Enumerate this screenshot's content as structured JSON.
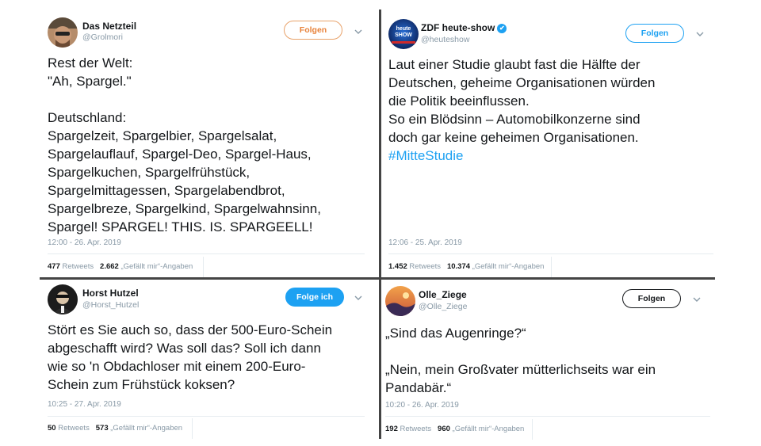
{
  "tweets": [
    {
      "name": "Das Netzteil",
      "handle": "@Grolmori",
      "follow_label": "Folgen",
      "text": "Rest der Welt:\n\"Ah, Spargel.\"\n\nDeutschland:\nSpargelzeit, Spargelbier, Spargelsalat,\nSpargelauflauf, Spargel-Deo, Spargel-Haus,\nSpargelkuchen, Spargelfrühstück,\nSpargelmittagessen, Spargelabendbrot,\nSpargelbreze, Spargelkind, Spargelwahnsinn,\nSpargel! SPARGEL! THIS. IS. SPARGEELL!",
      "timestamp": "12:00 - 26. Apr. 2019",
      "retweets": "477",
      "retweets_label": "Retweets",
      "likes": "2.662",
      "likes_label": "„Gefällt mir“-Angaben"
    },
    {
      "name": "ZDF heute-show",
      "handle": "@heuteshow",
      "verified": "✔",
      "avatar_label": "heute SHOW",
      "follow_label": "Folgen",
      "text": "Laut einer Studie glaubt fast die Hälfte der\nDeutschen, geheime Organisationen würden\ndie Politik beeinflussen.\nSo ein Blödsinn – Automobilkonzerne sind\ndoch gar keine geheimen Organisationen.",
      "hashtag": "#MitteStudie",
      "timestamp": "12:06 - 25. Apr. 2019",
      "retweets": "1.452",
      "retweets_label": "Retweets",
      "likes": "10.374",
      "likes_label": "„Gefällt mir“-Angaben"
    },
    {
      "name": "Horst Hutzel",
      "handle": "@Horst_Hutzel",
      "follow_label": "Folge ich",
      "text": "Stört es Sie auch so, dass der 500-Euro-Schein\nabgeschafft wird? Was soll das? Soll ich dann\nwie so 'n Obdachloser mit einem 200-Euro-\nSchein zum Frühstück koksen?",
      "timestamp": "10:25 - 27. Apr. 2019",
      "retweets": "50",
      "retweets_label": "Retweets",
      "likes": "573",
      "likes_label": "„Gefällt mir“-Angaben"
    },
    {
      "name": "Olle_Ziege",
      "handle": "@Olle_Ziege",
      "follow_label": "Folgen",
      "text": "„Sind das Augenringe?“\n\n„Nein, mein Großvater mütterlichseits war ein\nPandabär.“",
      "timestamp": "10:20 - 26. Apr. 2019",
      "retweets": "192",
      "retweets_label": "Retweets",
      "likes": "960",
      "likes_label": "„Gefällt mir“-Angaben"
    }
  ],
  "colors": {
    "link_blue": "#1da1f2",
    "follow_orange": "#e8823a",
    "divider": "#444444",
    "muted": "#8899a6"
  },
  "icons": {
    "caret": "chevron-down-icon",
    "verified": "verified-badge-icon"
  }
}
